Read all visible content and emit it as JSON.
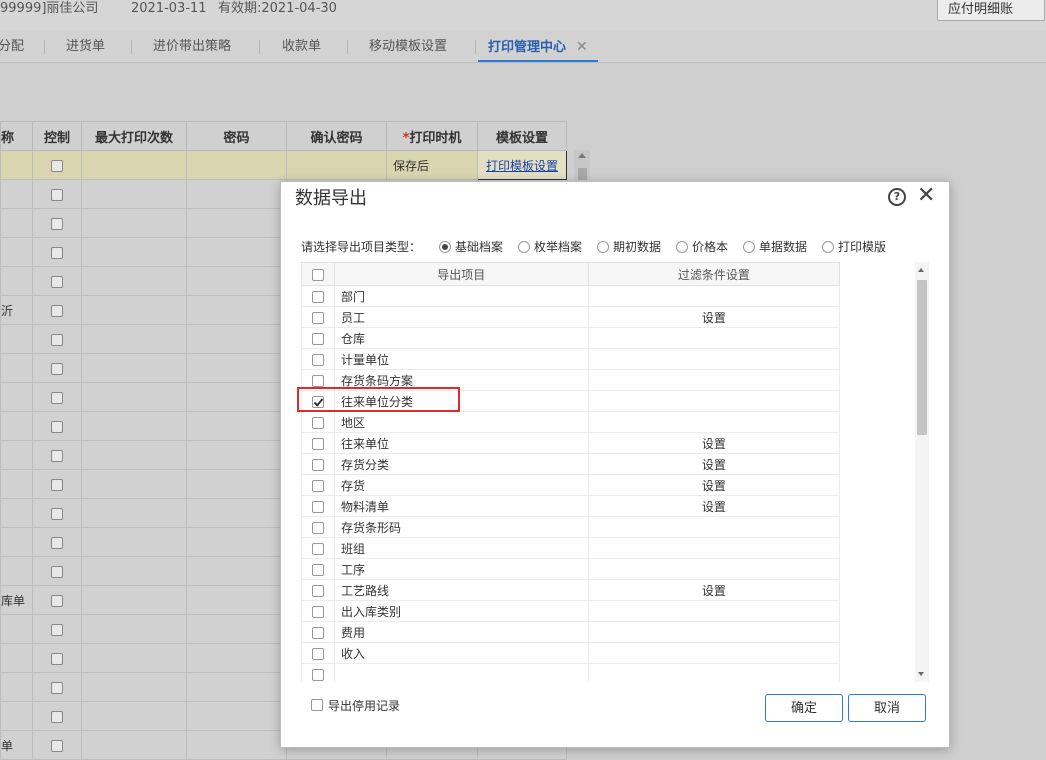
{
  "header": {
    "company": "99999]丽佳公司",
    "date": "2021-03-11",
    "valid": "有效期:2021-04-30",
    "right_button": "应付明细账"
  },
  "tabs": [
    {
      "label": "分配",
      "active": false
    },
    {
      "label": "进货单",
      "active": false
    },
    {
      "label": "进价带出策略",
      "active": false
    },
    {
      "label": "收款单",
      "active": false
    },
    {
      "label": "移动模板设置",
      "active": false
    },
    {
      "label": "打印管理中心",
      "active": true,
      "close": "✕"
    }
  ],
  "bg_table": {
    "headers": [
      "称",
      "控制",
      "最大打印次数",
      "密码",
      "确认密码",
      "打印时机",
      "模板设置"
    ],
    "required_mark": "*",
    "selected_row": {
      "print_timing": "保存后",
      "template": "打印模板设置"
    },
    "row_fragments": [
      "",
      "",
      "",
      "",
      "沂",
      "",
      "",
      "",
      "",
      "",
      "",
      "",
      "",
      "",
      "库单",
      "",
      "",
      "",
      "",
      "单"
    ]
  },
  "dialog": {
    "title": "数据导出",
    "type_label": "请选择导出项目类型：",
    "types": [
      {
        "label": "基础档案",
        "checked": true
      },
      {
        "label": "枚举档案",
        "checked": false
      },
      {
        "label": "期初数据",
        "checked": false
      },
      {
        "label": "价格本",
        "checked": false
      },
      {
        "label": "单据数据",
        "checked": false
      },
      {
        "label": "打印模版",
        "checked": false
      }
    ],
    "columns": {
      "item": "导出项目",
      "filter": "过滤条件设置"
    },
    "items": [
      {
        "name": "部门",
        "checked": false,
        "filter": ""
      },
      {
        "name": "员工",
        "checked": false,
        "filter": "设置"
      },
      {
        "name": "仓库",
        "checked": false,
        "filter": ""
      },
      {
        "name": "计量单位",
        "checked": false,
        "filter": ""
      },
      {
        "name": "存货条码方案",
        "checked": false,
        "filter": ""
      },
      {
        "name": "往来单位分类",
        "checked": true,
        "filter": ""
      },
      {
        "name": "地区",
        "checked": false,
        "filter": ""
      },
      {
        "name": "往来单位",
        "checked": false,
        "filter": "设置"
      },
      {
        "name": "存货分类",
        "checked": false,
        "filter": "设置"
      },
      {
        "name": "存货",
        "checked": false,
        "filter": "设置"
      },
      {
        "name": "物料清单",
        "checked": false,
        "filter": "设置"
      },
      {
        "name": "存货条形码",
        "checked": false,
        "filter": ""
      },
      {
        "name": "班组",
        "checked": false,
        "filter": ""
      },
      {
        "name": "工序",
        "checked": false,
        "filter": ""
      },
      {
        "name": "工艺路线",
        "checked": false,
        "filter": "设置"
      },
      {
        "name": "出入库类别",
        "checked": false,
        "filter": ""
      },
      {
        "name": "费用",
        "checked": false,
        "filter": ""
      },
      {
        "name": "收入",
        "checked": false,
        "filter": ""
      },
      {
        "name": "",
        "checked": false,
        "filter": ""
      }
    ],
    "export_disabled_label": "导出停用记录",
    "ok": "确定",
    "cancel": "取消"
  }
}
